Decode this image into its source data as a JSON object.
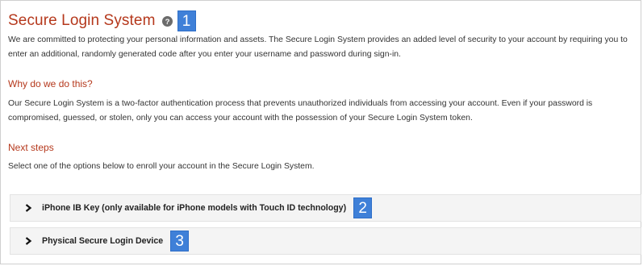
{
  "page_title": "Secure Login System",
  "help_icon": "question-circle-icon",
  "markers": {
    "title": "1",
    "iphone": "2",
    "device": "3"
  },
  "intro_text": "We are committed to protecting your personal information and assets. The Secure Login System provides an added level of security to your account by requiring you to enter an additional, randomly generated code after you enter your username and password during sign-in.",
  "why": {
    "heading": "Why do we do this?",
    "text": "Our Secure Login System is a two-factor authentication process that prevents unauthorized individuals from accessing your account. Even if your password is compromised, guessed, or stolen, only you can access your account with the possession of your Secure Login System token."
  },
  "next_steps": {
    "heading": "Next steps",
    "text": "Select one of the options below to enroll your account in the Secure Login System."
  },
  "options": [
    {
      "label": "iPhone IB Key (only available for iPhone models with Touch ID technology)",
      "icon": "chevron-right-icon"
    },
    {
      "label": "Physical Secure Login Device",
      "icon": "chevron-right-icon"
    }
  ],
  "colors": {
    "heading": "#b5381c",
    "marker": "#3f80d8",
    "accordion_bg": "#f4f4f4"
  }
}
